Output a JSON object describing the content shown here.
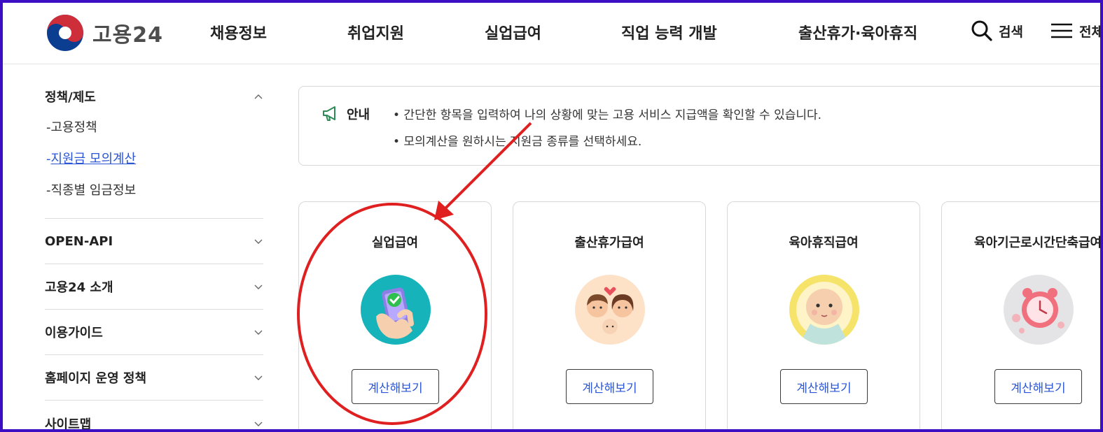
{
  "header": {
    "logo_text": "고용24",
    "nav": [
      "채용정보",
      "취업지원",
      "실업급여",
      "직업 능력 개발",
      "출산휴가·육아휴직"
    ],
    "search_label": "검색",
    "menu_label": "전체"
  },
  "sidebar": {
    "group_title": "정책/제도",
    "sub_items": [
      "고용정책",
      "지원금 모의계산",
      "직종별 임금정보"
    ],
    "sub_prefix": "-",
    "items": [
      "OPEN-API",
      "고용24 소개",
      "이용가이드",
      "홈페이지 운영 정책",
      "사이트맵"
    ]
  },
  "notice": {
    "label": "안내",
    "lines": [
      "• 간단한 항목을 입력하여 나의 상황에 맞는 고용 서비스 지급액을 확인할 수 있습니다.",
      "• 모의계산을 원하시는 지원금 종류를 선택하세요."
    ]
  },
  "cards": [
    {
      "title": "실업급여",
      "button": "계산해보기",
      "icon": "phone-check-icon"
    },
    {
      "title": "출산휴가급여",
      "button": "계산해보기",
      "icon": "family-icon"
    },
    {
      "title": "육아휴직급여",
      "button": "계산해보기",
      "icon": "baby-icon"
    },
    {
      "title": "육아기근로시간단축급여",
      "button": "계산해보기",
      "icon": "alarm-clock-icon"
    }
  ],
  "colors": {
    "frame": "#3d0fc4",
    "link": "#2a55d6",
    "annotation": "#e02020",
    "notice_icon": "#2e8b57"
  }
}
